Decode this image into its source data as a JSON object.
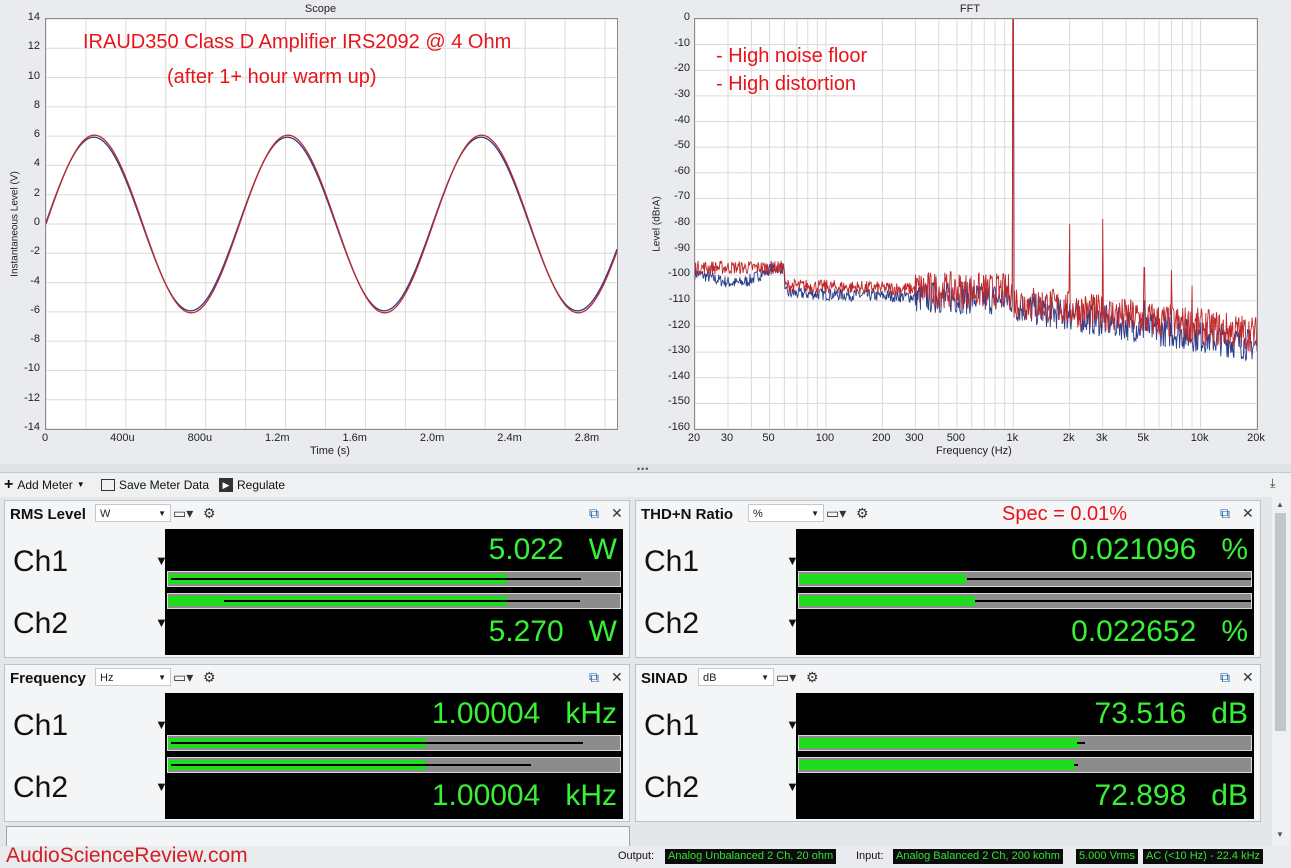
{
  "scope": {
    "title": "Scope",
    "annotation_line1": "IRAUD350 Class D Amplifier IRS2092 @ 4 Ohm",
    "annotation_line2": "(after 1+ hour warm up)",
    "xlabel": "Time (s)",
    "ylabel": "Instantaneous Level (V)",
    "yticks": [
      "14",
      "12",
      "10",
      "8",
      "6",
      "4",
      "2",
      "0",
      "-2",
      "-4",
      "-6",
      "-8",
      "-10",
      "-12",
      "-14"
    ],
    "xticks": [
      "0",
      "400u",
      "800u",
      "1.2m",
      "1.6m",
      "2.0m",
      "2.4m",
      "2.8m"
    ]
  },
  "fft": {
    "title": "FFT",
    "annotation_line1": "- High noise floor",
    "annotation_line2": "- High distortion",
    "xlabel": "Frequency (Hz)",
    "ylabel": "Level (dBrA)",
    "yticks": [
      "0",
      "-10",
      "-20",
      "-30",
      "-40",
      "-50",
      "-60",
      "-70",
      "-80",
      "-90",
      "-100",
      "-110",
      "-120",
      "-130",
      "-140",
      "-150",
      "-160"
    ],
    "xticks": [
      "20",
      "30",
      "50",
      "100",
      "200",
      "300",
      "500",
      "1k",
      "2k",
      "3k",
      "5k",
      "10k",
      "20k"
    ]
  },
  "toolbar": {
    "add_meter": "Add Meter",
    "save_meter_data": "Save Meter Data",
    "regulate": "Regulate"
  },
  "meters": {
    "rms": {
      "name": "RMS Level",
      "unit": "W",
      "ch1_label": "Ch1",
      "ch2_label": "Ch2",
      "ch1_value": "5.022",
      "ch2_value": "5.270",
      "ch1_unit": "W",
      "ch2_unit": "W",
      "ch1_fill": 0.75,
      "ch2_fill": 0.75
    },
    "thdn": {
      "name": "THD+N Ratio",
      "unit": "%",
      "spec_note": "Spec = 0.01%",
      "ch1_label": "Ch1",
      "ch2_label": "Ch2",
      "ch1_value": "0.021096",
      "ch2_value": "0.022652",
      "ch1_unit": "%",
      "ch2_unit": "%",
      "ch1_fill": 0.37,
      "ch2_fill": 0.39
    },
    "freq": {
      "name": "Frequency",
      "unit": "Hz",
      "ch1_label": "Ch1",
      "ch2_label": "Ch2",
      "ch1_value": "1.00004",
      "ch2_value": "1.00004",
      "ch1_unit": "kHz",
      "ch2_unit": "kHz",
      "ch1_fill": 0.57,
      "ch2_fill": 0.57
    },
    "sinad": {
      "name": "SINAD",
      "unit": "dB",
      "ch1_label": "Ch1",
      "ch2_label": "Ch2",
      "ch1_value": "73.516",
      "ch2_value": "72.898",
      "ch1_unit": "dB",
      "ch2_unit": "dB",
      "ch1_fill": 0.62,
      "ch2_fill": 0.61
    }
  },
  "status": {
    "watermark": "AudioScienceReview.com",
    "output_label": "Output:",
    "output_value": "Analog Unbalanced 2 Ch, 20 ohm",
    "input_label": "Input:",
    "input_value": "Analog Balanced 2 Ch, 200 kohm",
    "level_value": "5.000 Vrms",
    "coupling_value": "AC (<10 Hz) - 22.4 kHz"
  },
  "colors": {
    "trace_red": "#c0282a",
    "trace_blue": "#2c3e8c",
    "annotation_red": "#e8141a",
    "meter_green": "#38f036"
  }
}
